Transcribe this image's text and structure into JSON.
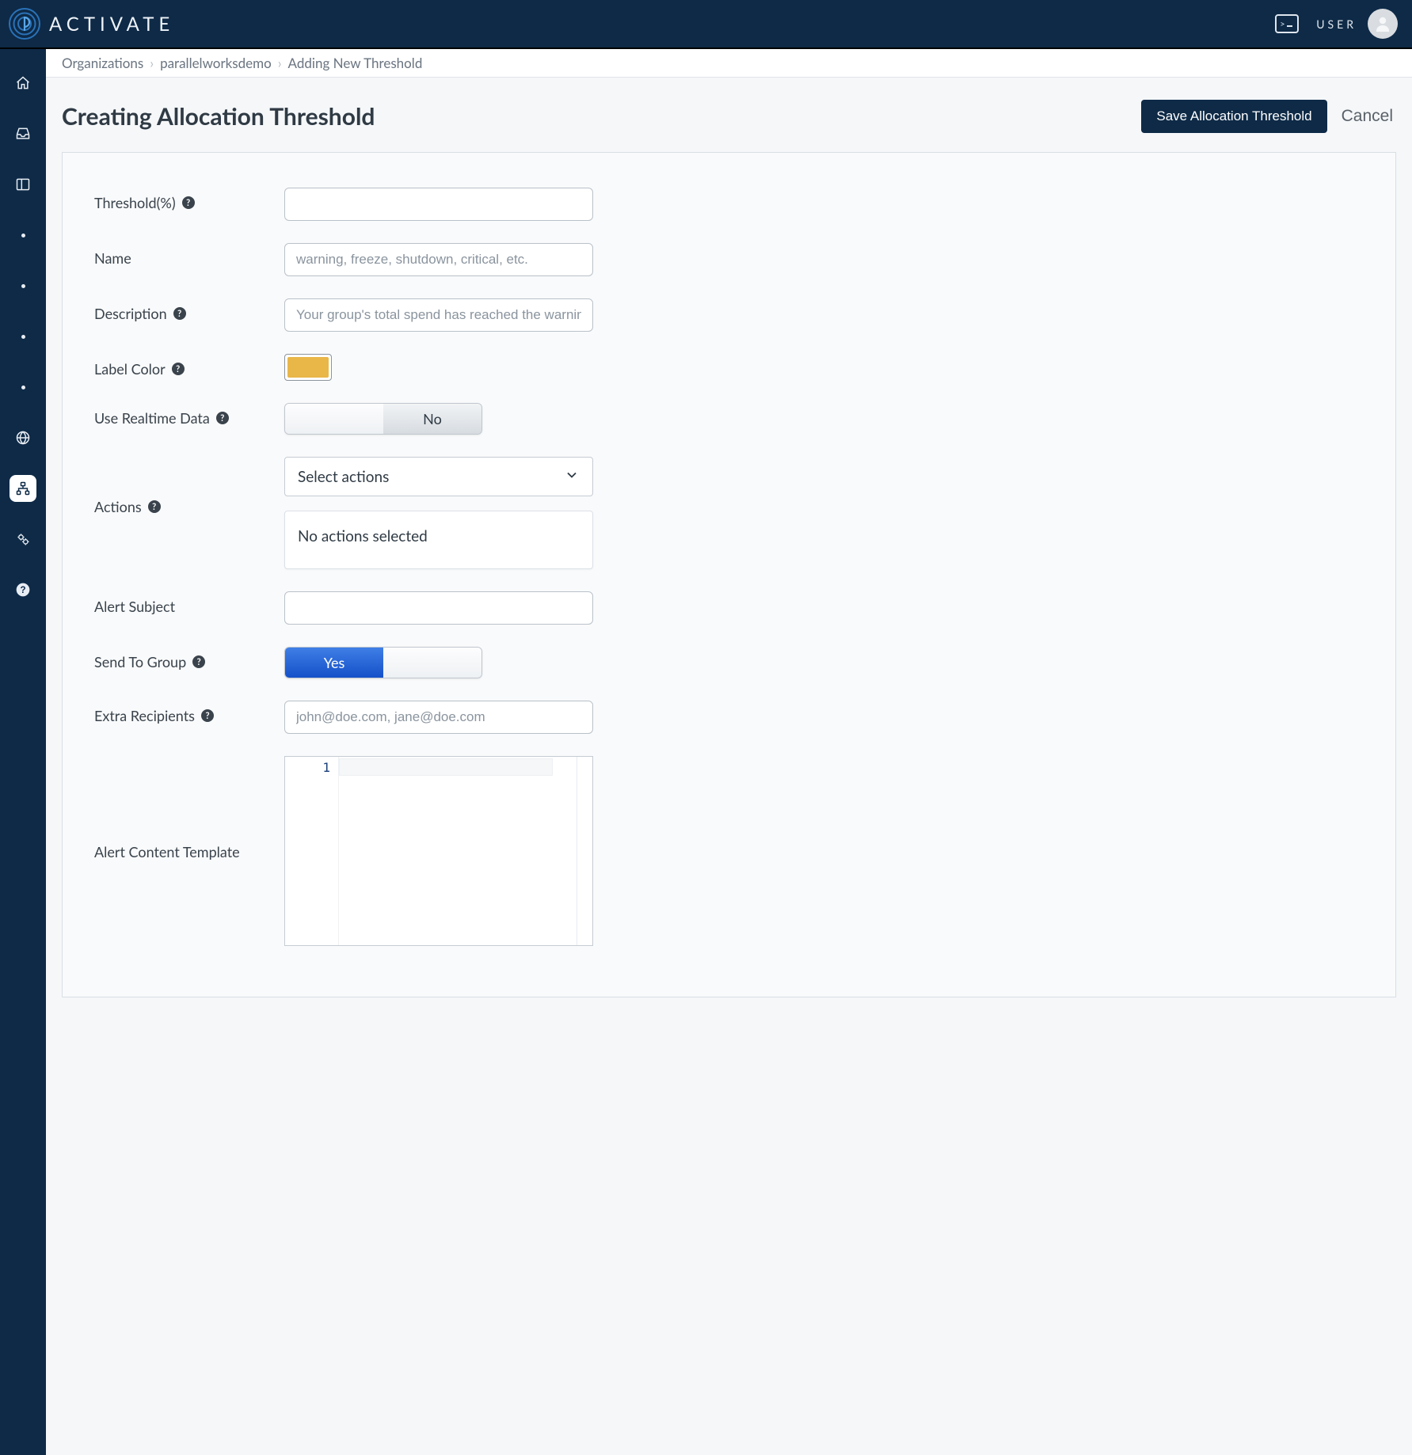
{
  "brand_name": "ACTIVATE",
  "topbar": {
    "user_label": "USER"
  },
  "breadcrumb": {
    "items": [
      "Organizations",
      "parallelworksdemo",
      "Adding New Threshold"
    ]
  },
  "page": {
    "title": "Creating Allocation Threshold",
    "save_label": "Save Allocation Threshold",
    "cancel_label": "Cancel"
  },
  "form": {
    "threshold": {
      "label": "Threshold(%)",
      "value": "",
      "placeholder": ""
    },
    "name": {
      "label": "Name",
      "value": "",
      "placeholder": "warning, freeze, shutdown, critical, etc."
    },
    "description": {
      "label": "Description",
      "value": "",
      "placeholder": "Your group's total spend has reached the warning lev"
    },
    "label_color": {
      "label": "Label Color",
      "value_hex": "#e9b648"
    },
    "realtime": {
      "label": "Use Realtime Data",
      "value": "No",
      "no_label": "No"
    },
    "actions": {
      "label": "Actions",
      "select_placeholder": "Select actions",
      "empty_text": "No actions selected",
      "selected": []
    },
    "alert_subject": {
      "label": "Alert Subject",
      "value": "",
      "placeholder": ""
    },
    "send_to_group": {
      "label": "Send To Group",
      "value": "Yes",
      "yes_label": "Yes"
    },
    "extra_recipients": {
      "label": "Extra Recipients",
      "value": "",
      "placeholder": "john@doe.com, jane@doe.com"
    },
    "alert_content": {
      "label": "Alert Content Template",
      "line_number": "1",
      "value": ""
    }
  },
  "sidebar_icons": [
    "home-icon",
    "inbox-icon",
    "panel-icon",
    "dot-icon",
    "dot-icon",
    "dot-icon",
    "dot-icon",
    "globe-icon",
    "org-tree-icon",
    "gears-icon",
    "help-icon"
  ]
}
